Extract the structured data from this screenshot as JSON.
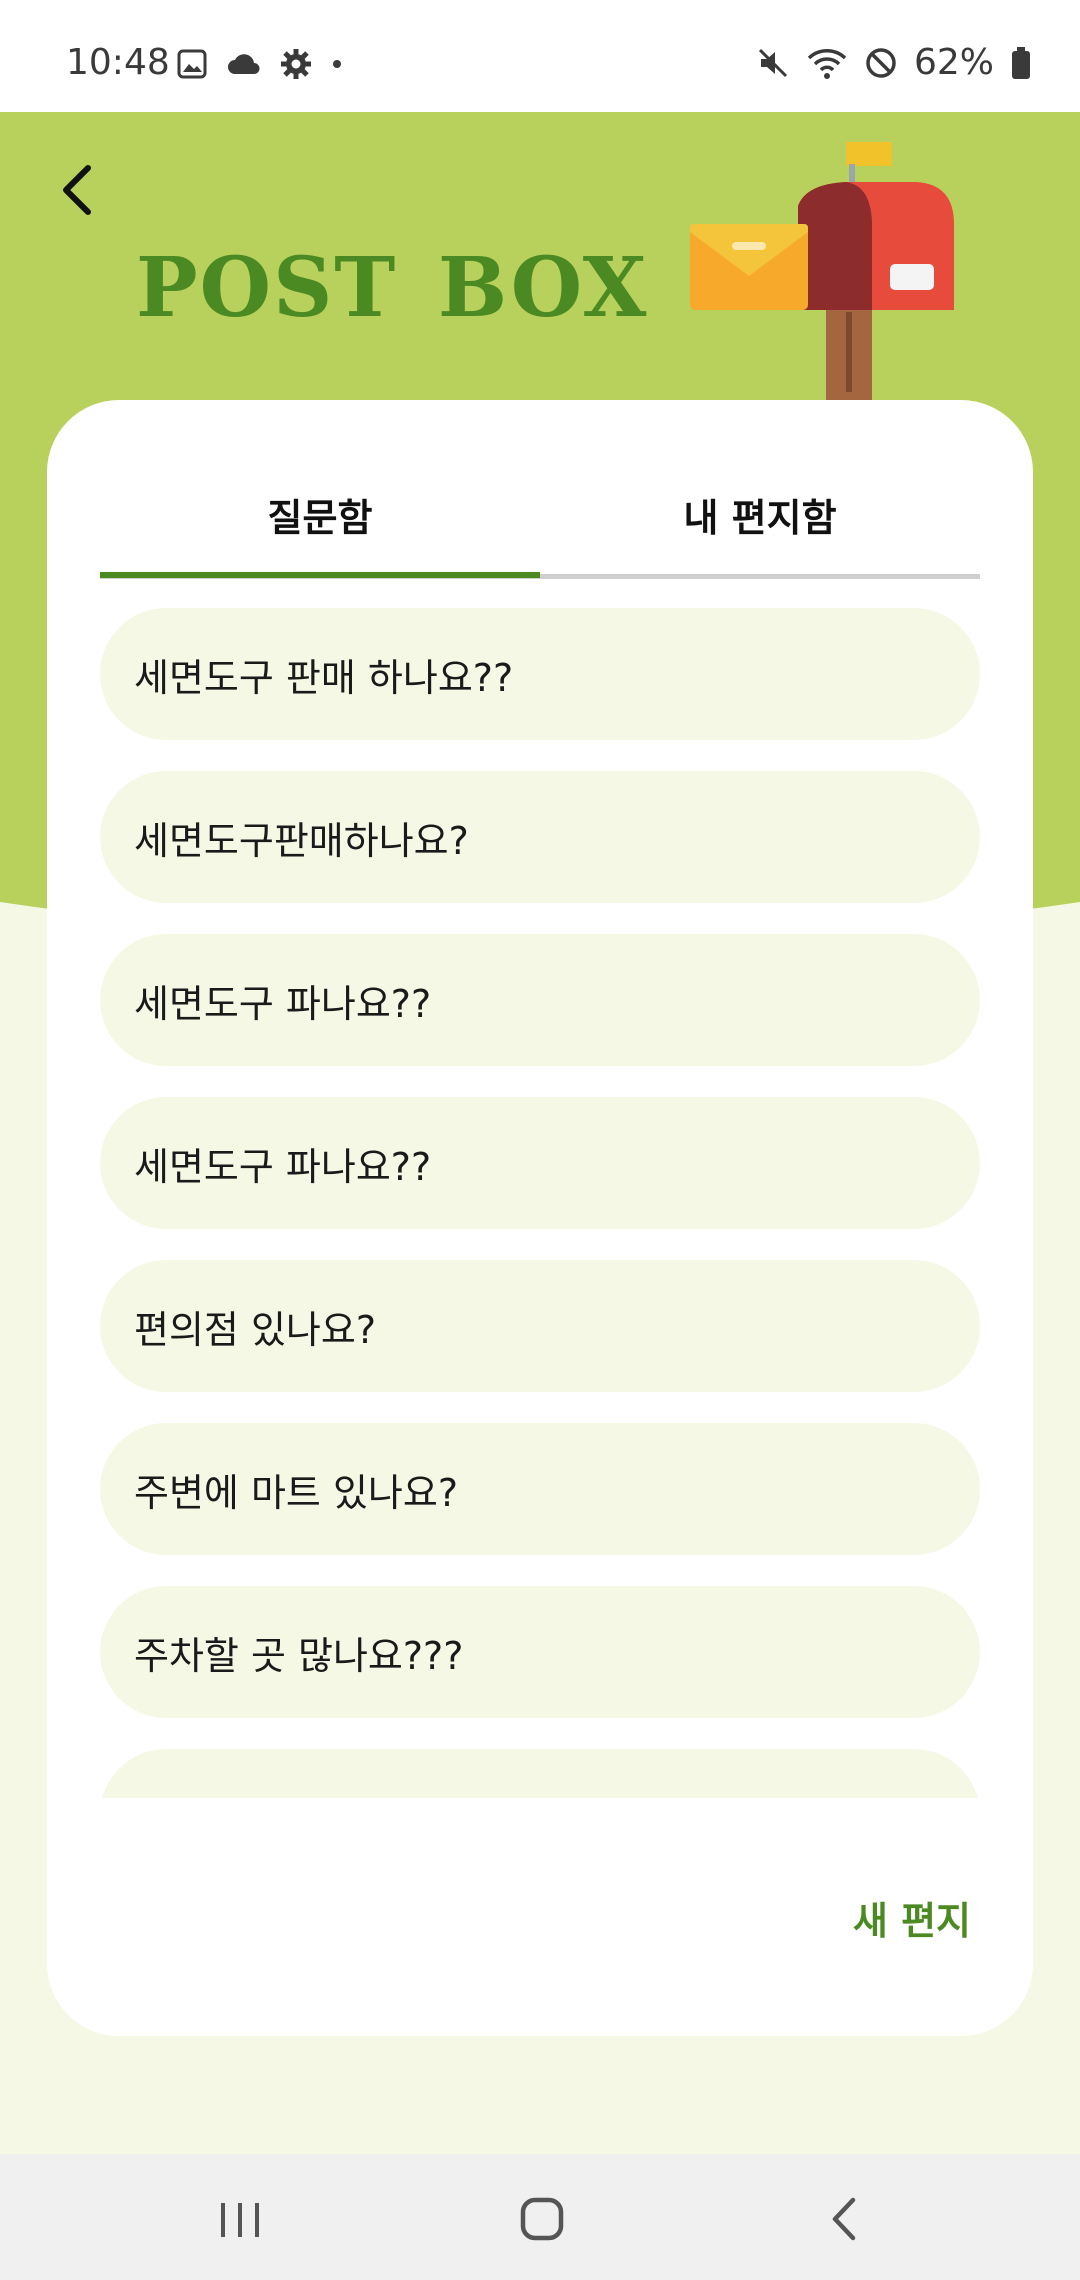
{
  "status": {
    "time": "10:48",
    "battery": "62%"
  },
  "header": {
    "title": "POST BOX"
  },
  "tabs": [
    {
      "label": "질문함",
      "active": true
    },
    {
      "label": "내 편지함",
      "active": false
    }
  ],
  "questions": [
    "세면도구 판매 하나요??",
    "세면도구판매하나요?",
    "세면도구 파나요??",
    "세면도구 파나요??",
    "편의점 있나요?",
    "주변에 마트 있나요?",
    "주차할 곳 많나요???",
    ""
  ],
  "actions": {
    "new_letter": "새 편지"
  },
  "colors": {
    "accent": "#4b8a22",
    "header_band": "#b8d15c",
    "item_background": "#f6f8e6"
  },
  "icons": {
    "back": "back-arrow-icon",
    "mailbox": "mailbox-icon"
  }
}
